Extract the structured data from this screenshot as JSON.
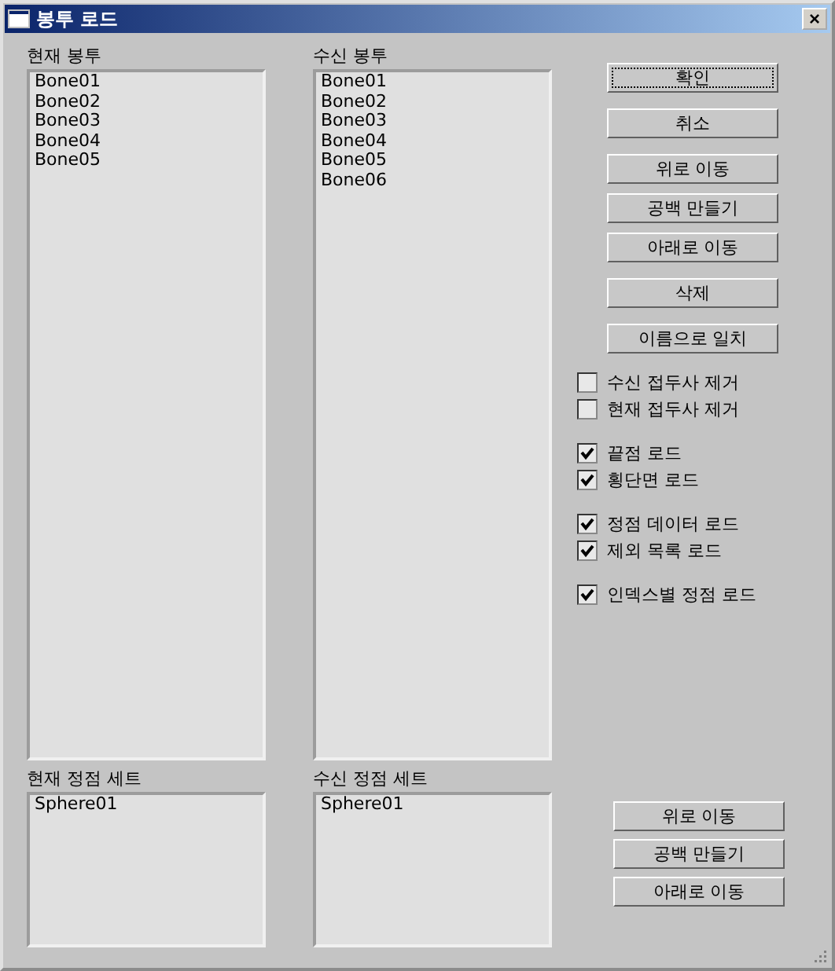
{
  "window": {
    "title": "봉투 로드",
    "close": "×"
  },
  "top_lists": [
    {
      "label": "현재 봉투",
      "items": [
        "Bone01",
        "Bone02",
        "Bone03",
        "Bone04",
        "Bone05"
      ]
    },
    {
      "label": "수신 봉투",
      "items": [
        "Bone01",
        "Bone02",
        "Bone03",
        "Bone04",
        "Bone05",
        "Bone06"
      ]
    }
  ],
  "right_panel": [
    [
      {
        "kind": "button",
        "label": "확인",
        "focused": true
      }
    ],
    [
      {
        "kind": "button",
        "label": "취소",
        "focused": false
      }
    ],
    [
      {
        "kind": "button",
        "label": "위로 이동",
        "focused": false
      },
      {
        "kind": "button",
        "label": "공백 만들기",
        "focused": false
      },
      {
        "kind": "button",
        "label": "아래로 이동",
        "focused": false
      }
    ],
    [
      {
        "kind": "button",
        "label": "삭제",
        "focused": false
      }
    ],
    [
      {
        "kind": "button",
        "label": "이름으로 일치",
        "focused": false
      }
    ],
    [
      {
        "kind": "checkbox",
        "label": "수신 접두사 제거",
        "checked": false
      },
      {
        "kind": "checkbox",
        "label": "현재 접두사 제거",
        "checked": false
      }
    ],
    [
      {
        "kind": "checkbox",
        "label": "끝점 로드",
        "checked": true
      },
      {
        "kind": "checkbox",
        "label": "횡단면 로드",
        "checked": true
      }
    ],
    [
      {
        "kind": "checkbox",
        "label": "정점 데이터 로드",
        "checked": true
      },
      {
        "kind": "checkbox",
        "label": "제외 목록 로드",
        "checked": true
      }
    ],
    [
      {
        "kind": "checkbox",
        "label": "인덱스별 정점 로드",
        "checked": true
      }
    ]
  ],
  "bottom_lists": [
    {
      "label": "현재 정점 세트",
      "items": [
        "Sphere01"
      ]
    },
    {
      "label": "수신 정점 세트",
      "items": [
        "Sphere01"
      ]
    }
  ],
  "bottom_buttons": [
    "위로 이동",
    "공백 만들기",
    "아래로 이동"
  ]
}
